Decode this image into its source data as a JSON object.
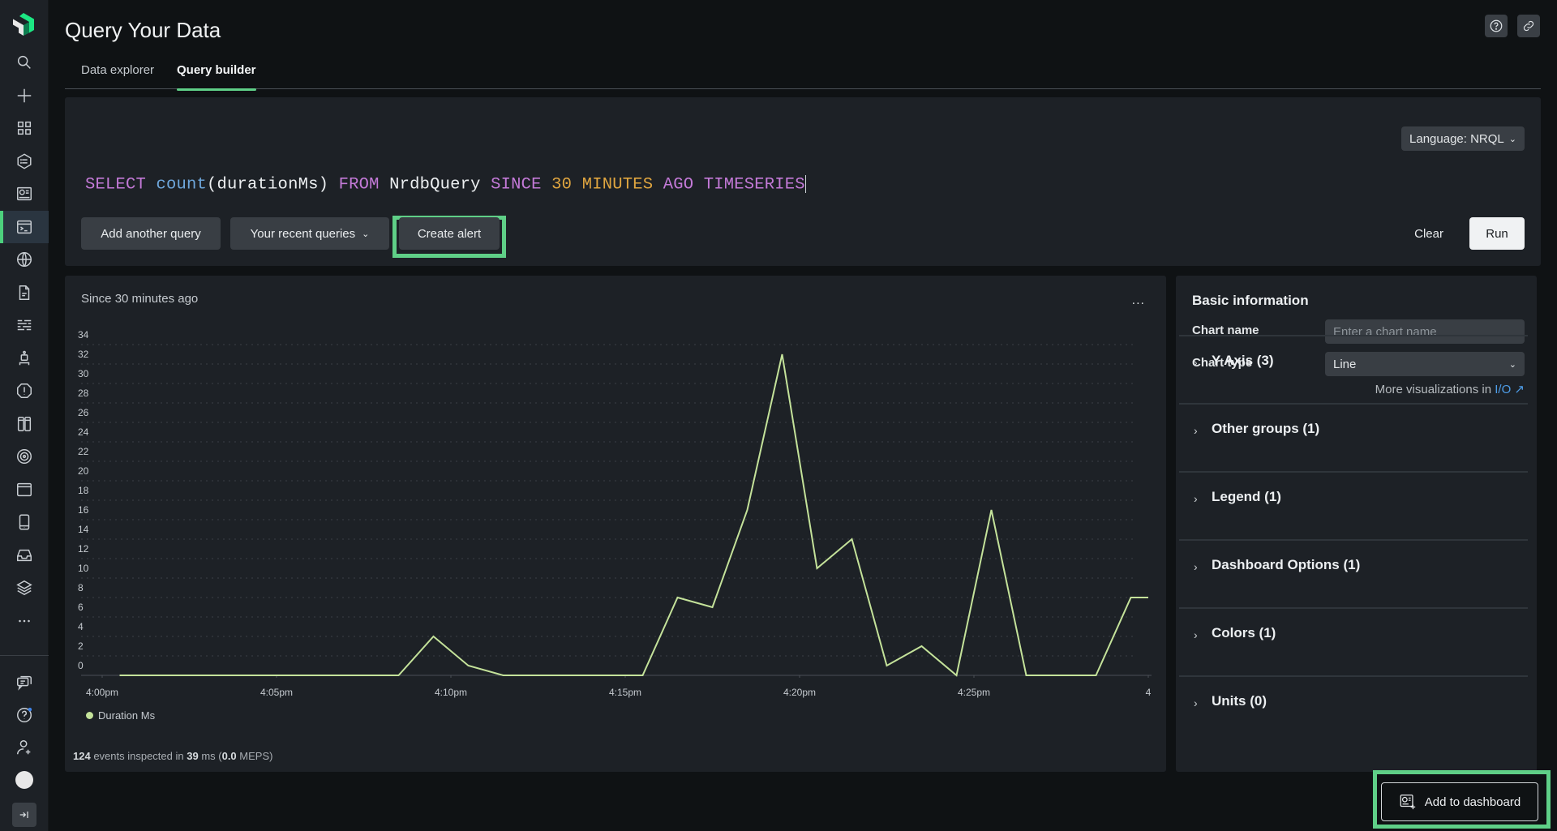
{
  "app": {
    "title": "Query Your Data",
    "tabs": [
      {
        "label": "Data explorer",
        "active": false
      },
      {
        "label": "Query builder",
        "active": true
      }
    ],
    "accent_color": "#5fcf87"
  },
  "sidebar": {
    "items": [
      {
        "icon": "search-icon"
      },
      {
        "icon": "add-icon"
      },
      {
        "icon": "grid-apps-icon"
      },
      {
        "icon": "entity-list-icon"
      },
      {
        "icon": "dashboard-icon"
      },
      {
        "icon": "terminal-query-icon",
        "active": true
      },
      {
        "icon": "globe-icon"
      },
      {
        "icon": "document-icon"
      },
      {
        "icon": "logs-icon"
      },
      {
        "icon": "robot-icon"
      },
      {
        "icon": "alert-icon"
      },
      {
        "icon": "columns-icon"
      },
      {
        "icon": "target-icon"
      },
      {
        "icon": "browser-icon"
      },
      {
        "icon": "mobile-icon"
      },
      {
        "icon": "inbox-icon"
      },
      {
        "icon": "layers-icon"
      },
      {
        "icon": "more-icon"
      }
    ],
    "bottom_items": [
      {
        "icon": "feedback-icon"
      },
      {
        "icon": "help-icon"
      },
      {
        "icon": "add-user-icon"
      },
      {
        "icon": "avatar-icon"
      },
      {
        "icon": "collapse-sidebar-icon"
      }
    ]
  },
  "top_actions": [
    {
      "icon": "help-icon"
    },
    {
      "icon": "link-icon"
    }
  ],
  "query": {
    "language_label": "Language: NRQL",
    "tokens": [
      {
        "text": "SELECT",
        "type": "kw"
      },
      {
        "text": " ",
        "type": "id"
      },
      {
        "text": "count",
        "type": "fn"
      },
      {
        "text": "(durationMs)",
        "type": "id"
      },
      {
        "text": " ",
        "type": "id"
      },
      {
        "text": "FROM",
        "type": "kw"
      },
      {
        "text": " NrdbQuery ",
        "type": "id"
      },
      {
        "text": "SINCE",
        "type": "kw"
      },
      {
        "text": " ",
        "type": "id"
      },
      {
        "text": "30",
        "type": "num"
      },
      {
        "text": " ",
        "type": "id"
      },
      {
        "text": "MINUTES",
        "type": "unit"
      },
      {
        "text": " ",
        "type": "id"
      },
      {
        "text": "AGO",
        "type": "kw"
      },
      {
        "text": " ",
        "type": "id"
      },
      {
        "text": "TIMESERIES",
        "type": "kw"
      }
    ],
    "add_query_label": "Add another query",
    "recent_queries_label": "Your recent queries",
    "create_alert_label": "Create alert",
    "clear_label": "Clear",
    "run_label": "Run"
  },
  "chart_panel": {
    "since_label": "Since 30 minutes ago",
    "menu_label": "...",
    "stats": {
      "events": "124",
      "events_text": " events inspected in ",
      "ms": "39",
      "ms_text": " ms (",
      "meps": "0.0",
      "meps_text": " MEPS)"
    }
  },
  "chart_data": {
    "type": "line",
    "title": "Since 30 minutes ago",
    "xlabel": "",
    "ylabel": "",
    "ylim": [
      0,
      34
    ],
    "yticks": [
      0,
      2,
      4,
      6,
      8,
      10,
      12,
      14,
      16,
      18,
      20,
      22,
      24,
      26,
      28,
      30,
      32,
      34
    ],
    "xticks": [
      "4:00pm",
      "4:05pm",
      "4:10pm",
      "4:15pm",
      "4:20pm",
      "4:25pm",
      "4"
    ],
    "x_minutes_from_4pm": [
      0.5,
      1.5,
      2.5,
      3.5,
      4.5,
      5.5,
      6.5,
      7.5,
      8.5,
      9.5,
      10.5,
      11.5,
      12.5,
      13.5,
      14.5,
      15.5,
      16.5,
      17.5,
      18.5,
      19.5,
      20.5,
      21.5,
      22.5,
      23.5,
      24.5,
      25.5,
      26.5,
      27.5,
      28.5,
      29.5,
      30.5
    ],
    "grid": true,
    "legend_position": "bottom-left",
    "series": [
      {
        "name": "Duration Ms",
        "color": "#c4e29a",
        "values": [
          0,
          0,
          0,
          0,
          0,
          0,
          0,
          0,
          0,
          4,
          1,
          0,
          0,
          0,
          0,
          0,
          8,
          7,
          17,
          33,
          11,
          14,
          1,
          3,
          0,
          17,
          0,
          0,
          0,
          8,
          8
        ]
      }
    ]
  },
  "config": {
    "title": "Basic information",
    "chart_name_label": "Chart name",
    "chart_name_placeholder": "Enter a chart name",
    "chart_name_value": "",
    "chart_type_label": "Chart type",
    "chart_type_value": "Line",
    "more_viz_text": "More visualizations in ",
    "more_viz_link": "I/O",
    "sections": [
      {
        "label": "Y Axis (3)"
      },
      {
        "label": "Other groups (1)"
      },
      {
        "label": "Legend (1)"
      },
      {
        "label": "Dashboard Options (1)"
      },
      {
        "label": "Colors (1)"
      },
      {
        "label": "Units (0)"
      }
    ]
  },
  "footer": {
    "add_to_dashboard_label": "Add to dashboard"
  }
}
